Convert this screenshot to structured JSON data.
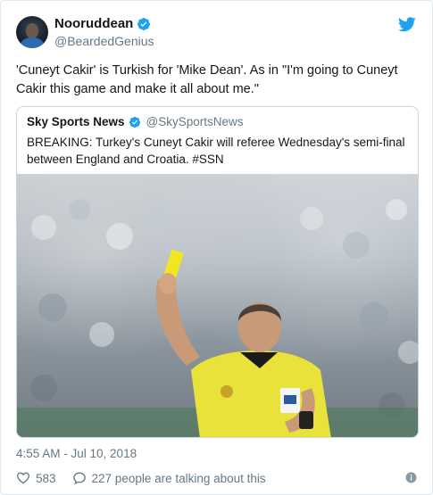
{
  "tweet": {
    "display_name": "Nooruddean",
    "handle": "@BeardedGenius",
    "text": "'Cuneyt Cakir' is Turkish for 'Mike Dean'. As in \"I'm going to Cuneyt Cakir this game and make it all about me.\"",
    "timestamp": "4:55 AM - Jul 10, 2018",
    "likes": "583",
    "conversation": "227 people are talking about this"
  },
  "quoted": {
    "display_name": "Sky Sports News",
    "handle": "@SkySportsNews",
    "text": "BREAKING: Turkey's Cuneyt Cakir will referee Wednesday's semi-final between England and Croatia. #SSN"
  },
  "icons": {
    "verified": "verified-badge-icon",
    "brand": "twitter-bird-icon",
    "like": "heart-icon",
    "reply": "speech-bubble-icon",
    "info": "info-icon"
  },
  "colors": {
    "verified": "#1da1f2",
    "brand": "#1da1f2",
    "muted": "#657786",
    "jersey": "#e8e23a",
    "card": "#f2e621"
  }
}
